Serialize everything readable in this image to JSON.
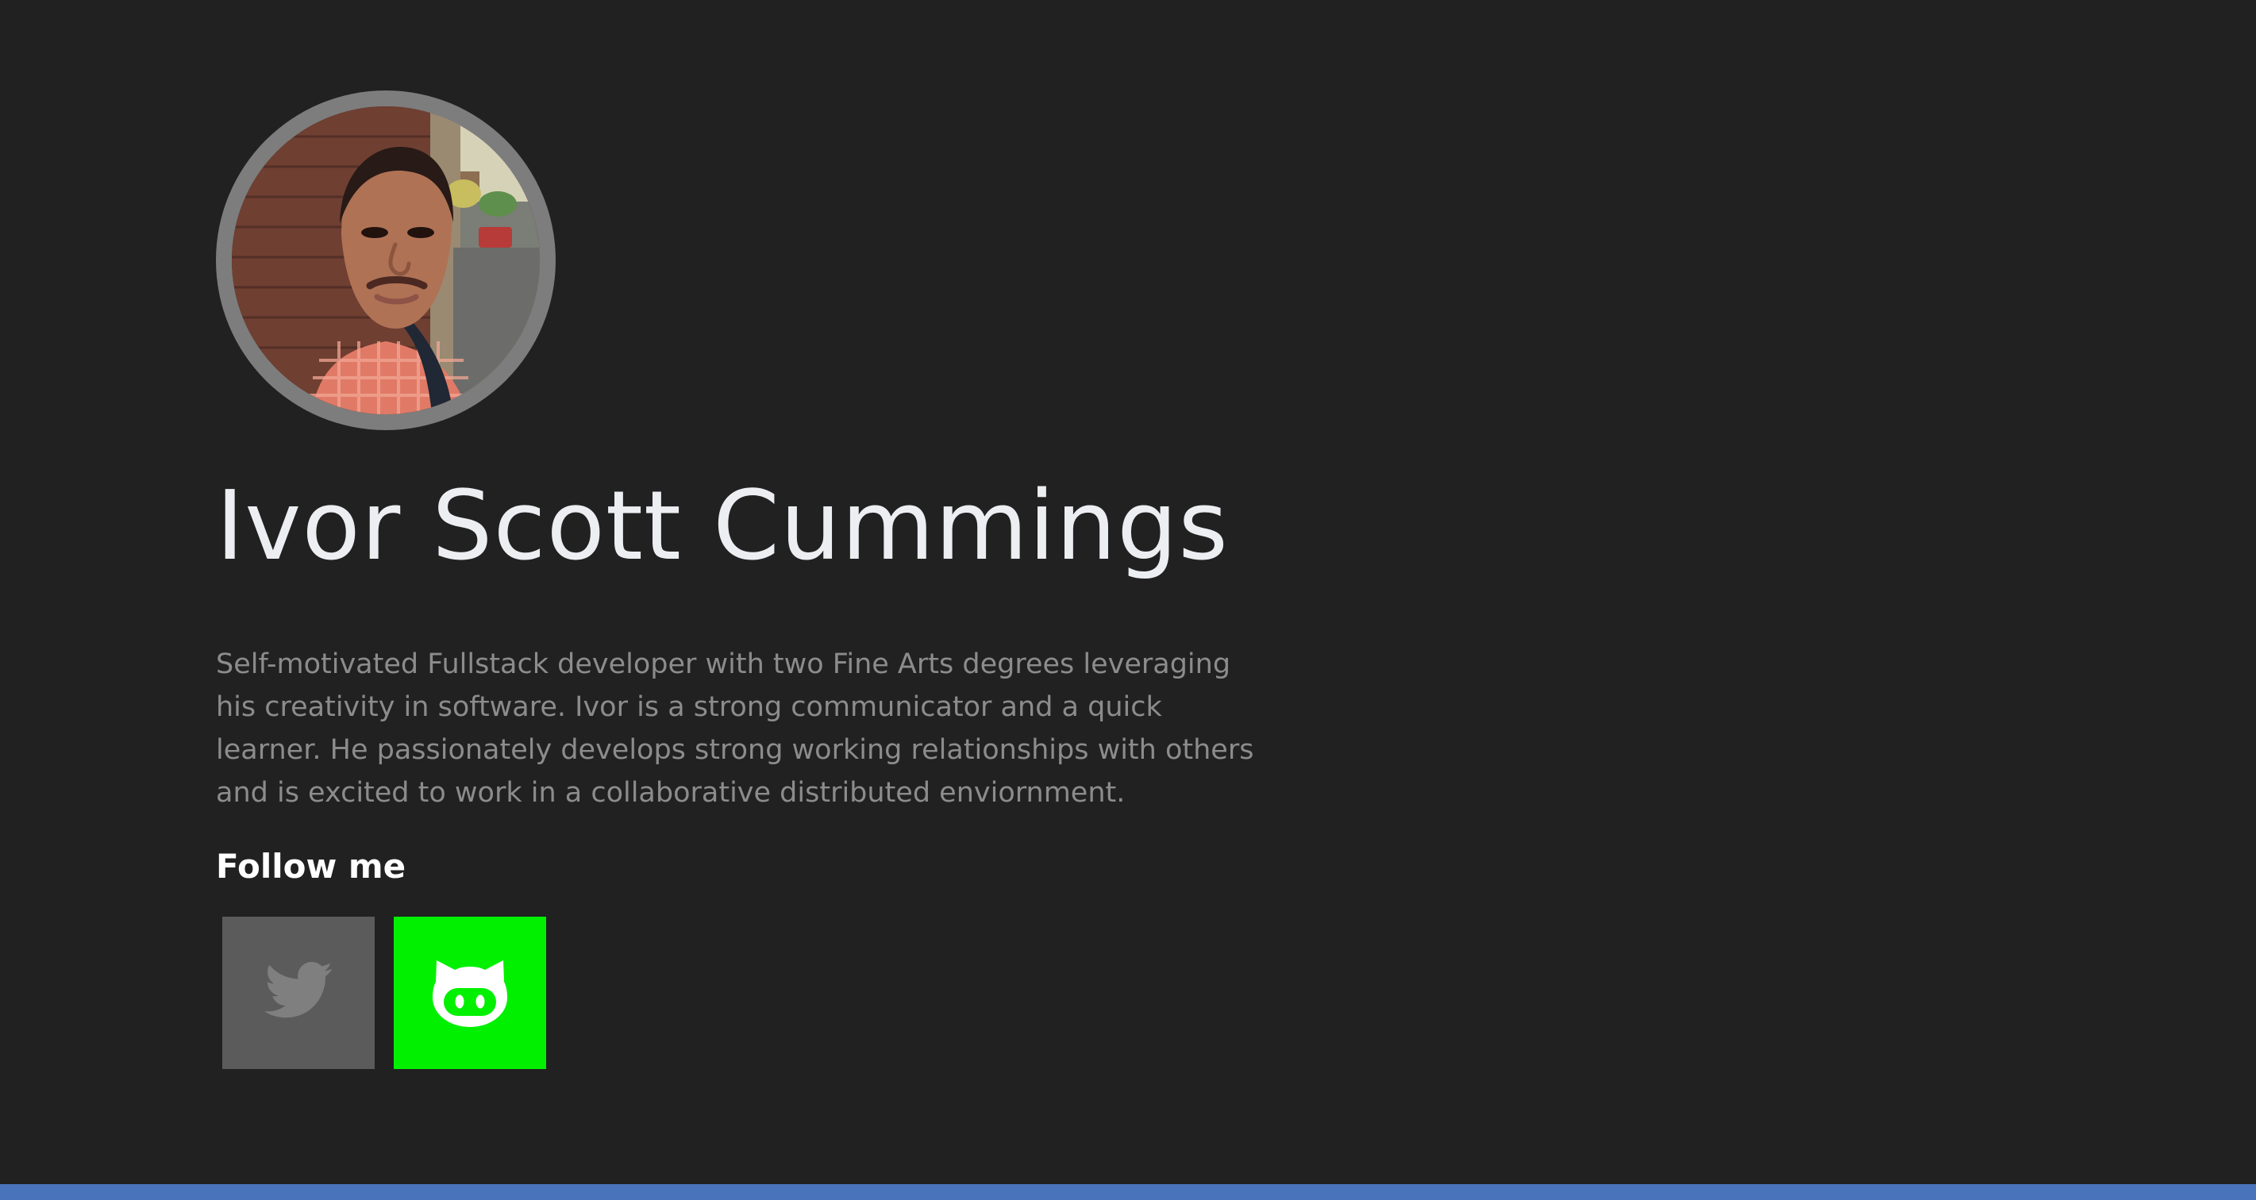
{
  "profile": {
    "name": "Ivor Scott Cummings",
    "bio": "Self-motivated Fullstack developer with two Fine Arts degrees leveraging his creativity in software. Ivor is a strong communicator and a quick learner. He passionately develops strong working relationships with others and is excited to work in a collaborative distributed enviornment.",
    "follow_heading": "Follow me"
  },
  "social_links": [
    {
      "icon": "twitter-icon",
      "color": "#5b5b5b"
    },
    {
      "icon": "github-icon",
      "color": "#00f000"
    }
  ],
  "colors": {
    "background": "#212121",
    "avatar_ring": "#7d7d7d",
    "name": "#eceef2",
    "bio": "#8c8c8c",
    "footer_bar": "#4973bb"
  }
}
